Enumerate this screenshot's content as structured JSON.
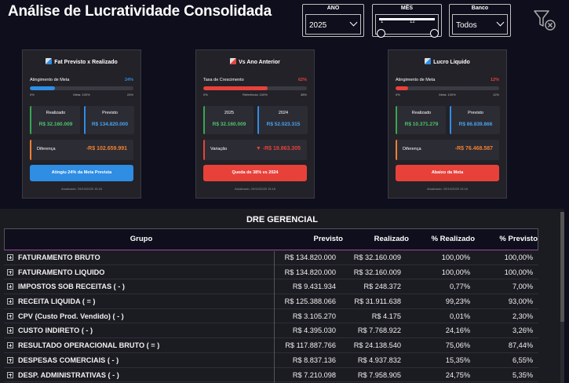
{
  "header": {
    "title": "Análise de Lucratividade Consolidada"
  },
  "slicers": {
    "ano": {
      "label": "ANO",
      "value": "2025"
    },
    "mes": {
      "label": "MÊS",
      "min": "1",
      "max": "12"
    },
    "banco": {
      "label": "Banco",
      "value": "Todos"
    }
  },
  "cards": [
    {
      "title": "Fat Previsto x Realizado",
      "meta_label": "Atingimento de Meta",
      "meta_pct": "24%",
      "progress": 0.24,
      "scale": [
        "0%",
        "Meta: 100%",
        "24%"
      ],
      "box1_label": "Realizado",
      "box1_value": "R$ 32.160.009",
      "box2_label": "Previsto",
      "box2_value": "R$ 134.820.000",
      "diff_label": "Diferença",
      "diff_value": "-R$ 102.659.991",
      "button": "Atingiu 24% da Meta Prevista",
      "updated": "Atualizado: 29/10/2025 15:16"
    },
    {
      "title": "Vs Ano Anterior",
      "meta_label": "Taxa de Crescimento",
      "meta_pct": "62%",
      "progress": 0.62,
      "scale": [
        "0%",
        "Referência: 100%",
        "38%"
      ],
      "box1_label": "2025",
      "box1_value": "R$ 32.160.009",
      "box2_label": "2024",
      "box2_value": "R$ 52.023.315",
      "diff_label": "Variação",
      "diff_value": "▼ -R$ 19.863.305",
      "button": "Queda de 38% vs 2024",
      "updated": "Atualizado: 29/10/2025 15:16"
    },
    {
      "title": "Lucro Liquido",
      "meta_label": "Atingimento de Meta",
      "meta_pct": "12%",
      "progress": 0.12,
      "scale": [
        "0%",
        "Meta: 100%",
        "12%"
      ],
      "box1_label": "Realizado",
      "box1_value": "R$ 10.371.279",
      "box2_label": "Previsto",
      "box2_value": "R$ 86.839.866",
      "diff_label": "Diferença",
      "diff_value": "-R$ 76.468.587",
      "button": "Abaixo da Meta",
      "updated": "Atualizado: 29/10/2025 15:16"
    }
  ],
  "colors": {
    "green": "#3aa655",
    "blue": "#2f8de4",
    "red": "#e8413a",
    "orange": "#f08030",
    "value_green": "#4cc76a",
    "value_blue": "#4aa3f0"
  },
  "dre": {
    "title": "DRE GERENCIAL",
    "columns": [
      "Grupo",
      "Previsto",
      "Realizado",
      "% Realizado",
      "% Previsto"
    ],
    "rows": [
      {
        "grupo": "FATURAMENTO BRUTO",
        "previsto": "R$ 134.820.000",
        "realizado": "R$ 32.160.009",
        "pct_realizado": "100,00%",
        "pct_previsto": "100,00%"
      },
      {
        "grupo": "FATURAMENTO LIQUIDO",
        "previsto": "R$ 134.820.000",
        "realizado": "R$ 32.160.009",
        "pct_realizado": "100,00%",
        "pct_previsto": "100,00%"
      },
      {
        "grupo": "IMPOSTOS SOB RECEITAS ( - )",
        "previsto": "R$ 9.431.934",
        "realizado": "R$ 248.372",
        "pct_realizado": "0,77%",
        "pct_previsto": "7,00%"
      },
      {
        "grupo": "RECEITA LIQUIDA ( = )",
        "previsto": "R$ 125.388.066",
        "realizado": "R$ 31.911.638",
        "pct_realizado": "99,23%",
        "pct_previsto": "93,00%"
      },
      {
        "grupo": "CPV (Custo Prod. Vendido) ( - )",
        "previsto": "R$ 3.105.270",
        "realizado": "R$ 4.175",
        "pct_realizado": "0,01%",
        "pct_previsto": "2,30%"
      },
      {
        "grupo": "CUSTO INDIRETO ( - )",
        "previsto": "R$ 4.395.030",
        "realizado": "R$ 7.768.922",
        "pct_realizado": "24,16%",
        "pct_previsto": "3,26%"
      },
      {
        "grupo": "RESULTADO OPERACIONAL BRUTO ( = )",
        "previsto": "R$ 117.887.766",
        "realizado": "R$ 24.138.540",
        "pct_realizado": "75,06%",
        "pct_previsto": "87,44%"
      },
      {
        "grupo": "DESPESAS COMERCIAIS ( - )",
        "previsto": "R$ 8.837.136",
        "realizado": "R$ 4.937.832",
        "pct_realizado": "15,35%",
        "pct_previsto": "6,55%"
      },
      {
        "grupo": "DESP. ADMINISTRATIVAS ( - )",
        "previsto": "R$ 7.210.098",
        "realizado": "R$ 7.958.905",
        "pct_realizado": "24,75%",
        "pct_previsto": "5,35%"
      }
    ]
  }
}
